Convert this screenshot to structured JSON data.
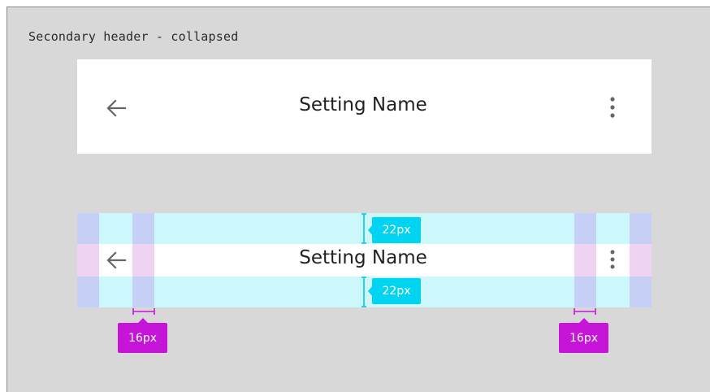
{
  "frame": {
    "title": "Secondary header - collapsed"
  },
  "header": {
    "back_icon": "arrow-left-icon",
    "title": "Setting Name",
    "menu_icon": "more-vertical-icon"
  },
  "spec": {
    "back_icon": "arrow-left-icon",
    "title": "Setting Name",
    "menu_icon": "more-vertical-icon",
    "top_padding": "22px",
    "bottom_padding": "22px",
    "left_margin": "16px",
    "right_margin": "16px"
  },
  "colors": {
    "frame_bg": "#d8d8d8",
    "padding_overlay": "#ccf7fb",
    "margin_overlay": "#c6cff5",
    "content_overlay": "#efd3f3",
    "padding_tag": "#00d4f0",
    "margin_tag": "#c614d9"
  }
}
